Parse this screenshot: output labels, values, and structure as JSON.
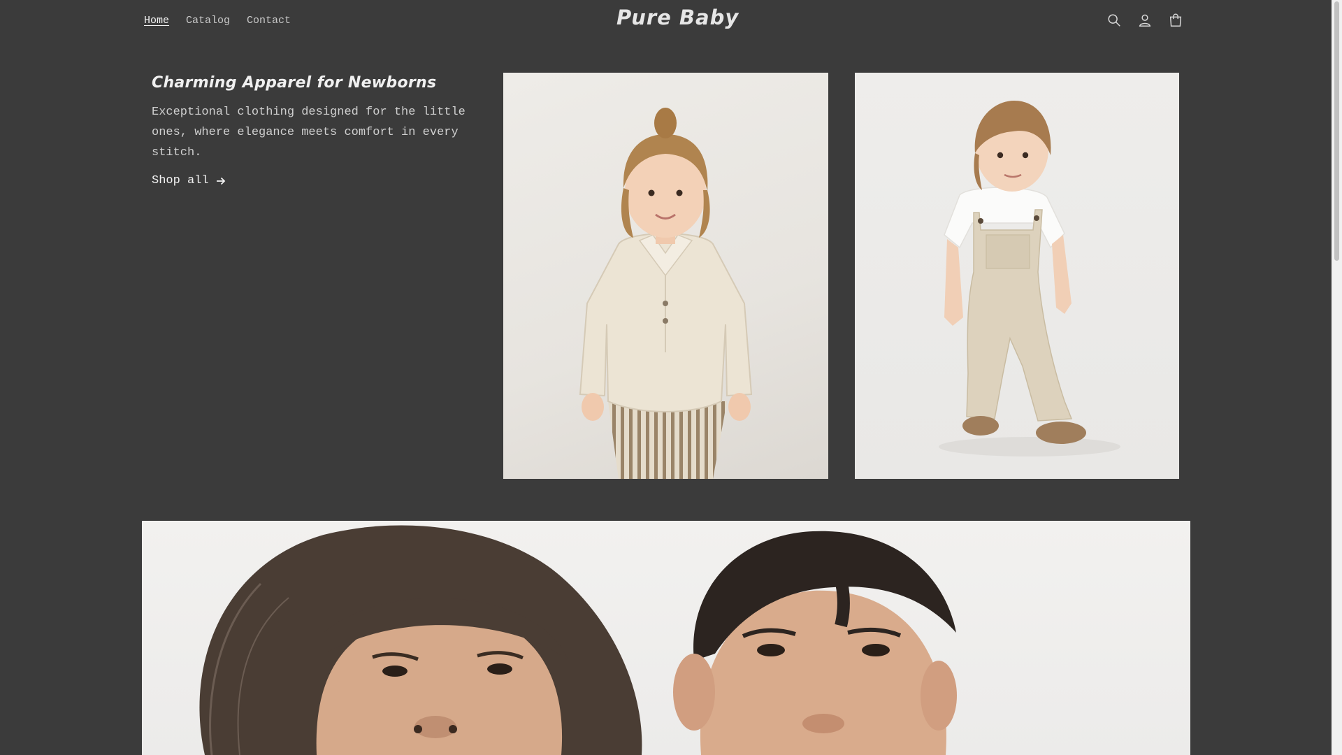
{
  "header": {
    "nav": [
      {
        "label": "Home",
        "active": true
      },
      {
        "label": "Catalog",
        "active": false
      },
      {
        "label": "Contact",
        "active": false
      }
    ],
    "logo": "Pure Baby",
    "icons": [
      "search-icon",
      "account-icon",
      "cart-icon"
    ]
  },
  "hero": {
    "title": "Charming Apparel for Newborns",
    "description": "Exceptional clothing designed for the little ones, where elegance meets comfort in every stitch.",
    "cta_label": "Shop all",
    "cta_icon": "arrow-right-icon"
  },
  "colors": {
    "background": "#3b3b3b",
    "text": "#e8e8e8",
    "photo_bg": "#eceae6"
  }
}
